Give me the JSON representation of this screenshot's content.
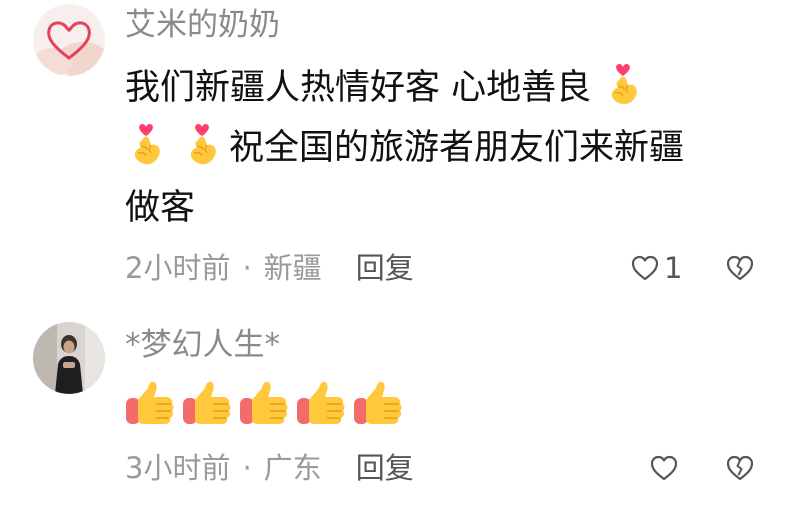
{
  "comments": [
    {
      "username": "艾米的奶奶",
      "avatar_icon": "heart-hands-avatar",
      "text_lines": [
        "我们新疆人热情好客 心地善良",
        "祝全国的旅游者朋友们来新疆",
        "做客"
      ],
      "emoji_icon": "finger-heart-emoji",
      "time": "2小时前",
      "separator": "·",
      "location": "新疆",
      "reply_label": "回复",
      "like_count": "1"
    },
    {
      "username": "*梦幻人生*",
      "avatar_icon": "person-photo-avatar",
      "emoji_icon": "thumbs-up-emoji",
      "emoji_count": 5,
      "time": "3小时前",
      "separator": "·",
      "location": "广东",
      "reply_label": "回复",
      "like_count": ""
    }
  ],
  "colors": {
    "text": "#111111",
    "muted": "#9a9a9a",
    "username": "#8a8a8a",
    "heart": "#ff3d6e",
    "hand": "#ffc83d",
    "sleeve": "#f36b6b"
  }
}
